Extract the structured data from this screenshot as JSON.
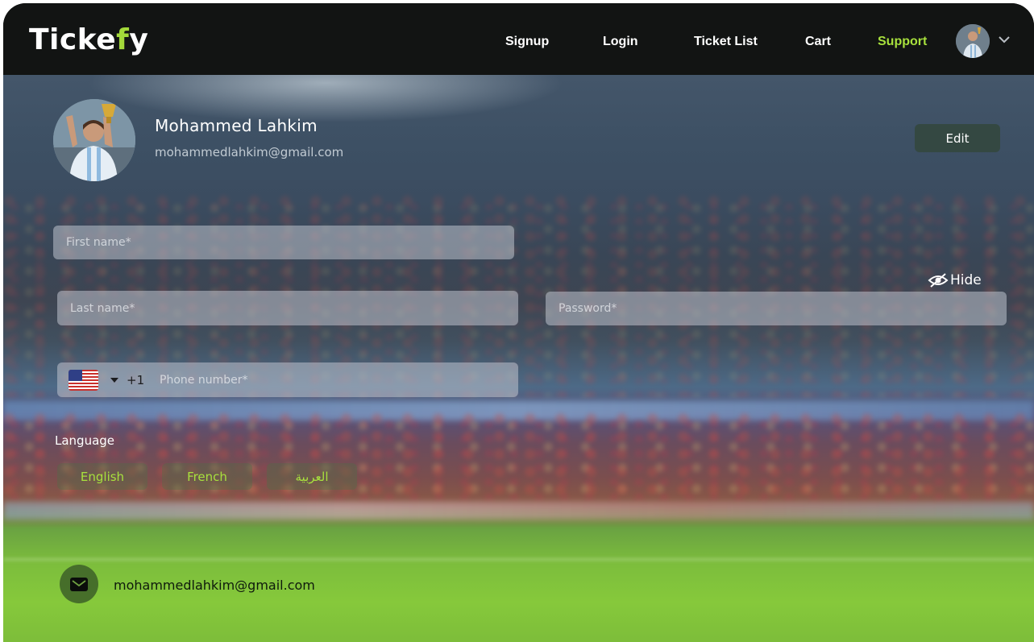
{
  "brand": {
    "logo_main": "Ticke",
    "logo_accent": "f",
    "logo_end": "y",
    "accent_color": "#a8e13d"
  },
  "nav": {
    "links": [
      {
        "label": "Signup"
      },
      {
        "label": "Login"
      },
      {
        "label": "Ticket List"
      },
      {
        "label": "Cart"
      },
      {
        "label": "Support",
        "active": true
      }
    ],
    "menu_icon": "chevron-down-icon"
  },
  "profile": {
    "name": "Mohammed Lahkim",
    "email": "mohammedlahkim@gmail.com",
    "edit_label": "Edit"
  },
  "form": {
    "first_name": {
      "placeholder": "First name*",
      "value": ""
    },
    "last_name": {
      "placeholder": "Last name*",
      "value": ""
    },
    "password": {
      "placeholder": "Password*",
      "value": "",
      "toggle_label": "Hide",
      "toggle_icon": "eye-slash-icon"
    },
    "phone": {
      "country_flag": "us-flag-icon",
      "dial_code": "+1",
      "placeholder": "Phone number*",
      "value": ""
    }
  },
  "language": {
    "title": "Language",
    "options": [
      "English",
      "French",
      "العربية"
    ]
  },
  "contact": {
    "icon": "mail-icon",
    "email": "mohammedlahkim@gmail.com"
  }
}
